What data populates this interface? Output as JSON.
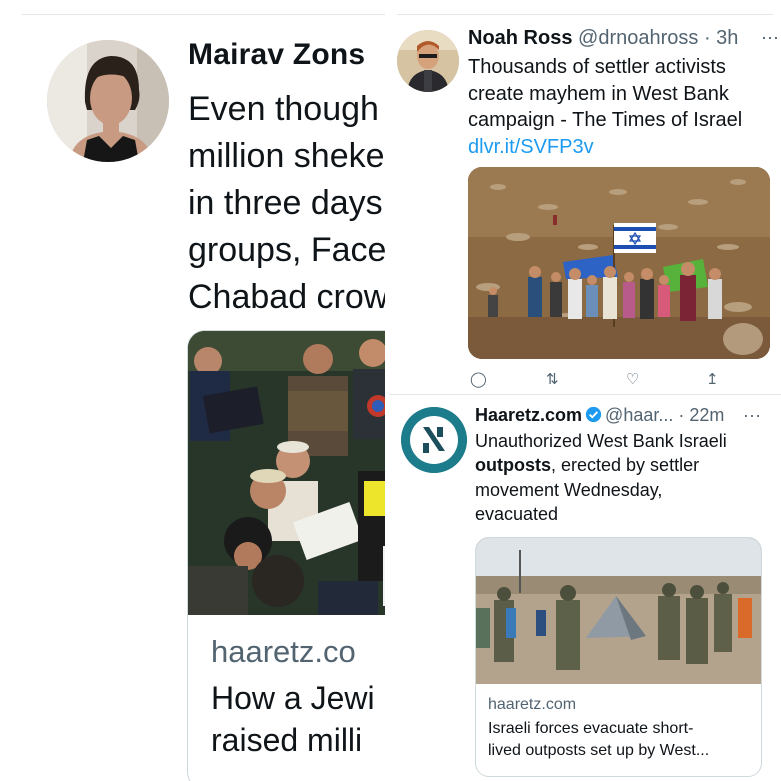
{
  "left": {
    "author_name": "Mairav Zons",
    "text_lines": [
      "Even though",
      "million sheke",
      "in three days",
      "groups, Face",
      "Chabad crow"
    ],
    "card": {
      "domain": "haaretz.co",
      "headline_lines": [
        "How a Jewi",
        "raised milli"
      ]
    }
  },
  "right_top": {
    "author_name": "Noah Ross",
    "handle": "@drnoahross",
    "time": "· 3h",
    "more_icon": "⋯",
    "text_lines": [
      "Thousands of settler activists",
      "create mayhem in West Bank",
      "campaign - The Times of Israel"
    ],
    "link": "dlvr.it/SVFP3v",
    "actions": {
      "reply_icon": "reply-icon",
      "retweet_icon": "retweet-icon",
      "like_icon": "heart-icon",
      "share_icon": "share-icon"
    }
  },
  "right_bottom": {
    "author_name": "Haaretz.com",
    "handle": "@haar...",
    "time": "· 22m",
    "more_icon": "···",
    "text_line1": "Unauthorized West Bank Israeli",
    "text_bold": "outposts",
    "text_line2_rest": ", erected by settler",
    "text_line3": "movement Wednesday,",
    "text_line4": "evacuated",
    "card": {
      "domain": "haaretz.com",
      "headline_lines": [
        "Israeli forces evacuate short-",
        "lived outposts set up by West..."
      ]
    }
  },
  "colors": {
    "link": "#1d9bf0",
    "secondary_text": "#536471",
    "verified": "#1d9bf0",
    "haaretz_brand": "#1d7c8c"
  }
}
